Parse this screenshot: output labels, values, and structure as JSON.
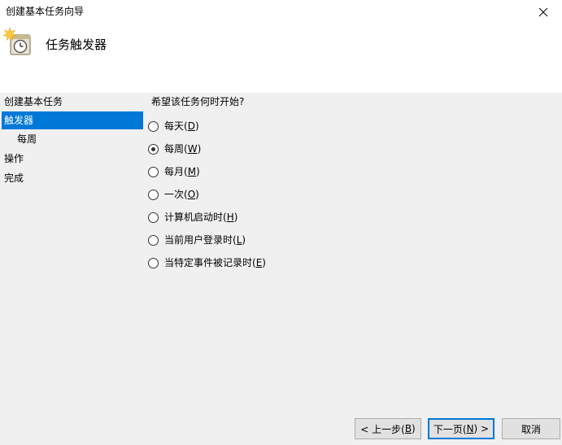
{
  "window": {
    "title": "创建基本任务向导"
  },
  "header": {
    "title": "任务触发器"
  },
  "nav": {
    "items": [
      {
        "label": "创建基本任务",
        "selected": false,
        "sub": false
      },
      {
        "label": "触发器",
        "selected": true,
        "sub": false
      },
      {
        "label": "每周",
        "selected": false,
        "sub": true
      },
      {
        "label": "操作",
        "selected": false,
        "sub": false
      },
      {
        "label": "完成",
        "selected": false,
        "sub": false
      }
    ]
  },
  "main": {
    "question": "希望该任务何时开始?",
    "options": [
      {
        "text": "每天(",
        "key": "D",
        "checked": false
      },
      {
        "text": "每周(",
        "key": "W",
        "checked": true
      },
      {
        "text": "每月(",
        "key": "M",
        "checked": false
      },
      {
        "text": "一次(",
        "key": "O",
        "checked": false
      },
      {
        "text": "计算机启动时(",
        "key": "H",
        "checked": false
      },
      {
        "text": "当前用户登录时(",
        "key": "L",
        "checked": false
      },
      {
        "text": "当特定事件被记录时(",
        "key": "E",
        "checked": false
      }
    ],
    "closing_paren": ")"
  },
  "buttons": {
    "back": {
      "prefix": "< 上一步(",
      "key": "B",
      "suffix": ")"
    },
    "next": {
      "prefix": "下一页(",
      "key": "N",
      "suffix": ") >"
    },
    "cancel": {
      "label": "取消"
    }
  },
  "colors": {
    "selection": "#0078d7",
    "background": "#f0f0f0",
    "header_background": "#ffffff"
  },
  "icons": {
    "close": "close-icon",
    "header": "scheduled-task-clock-icon"
  }
}
